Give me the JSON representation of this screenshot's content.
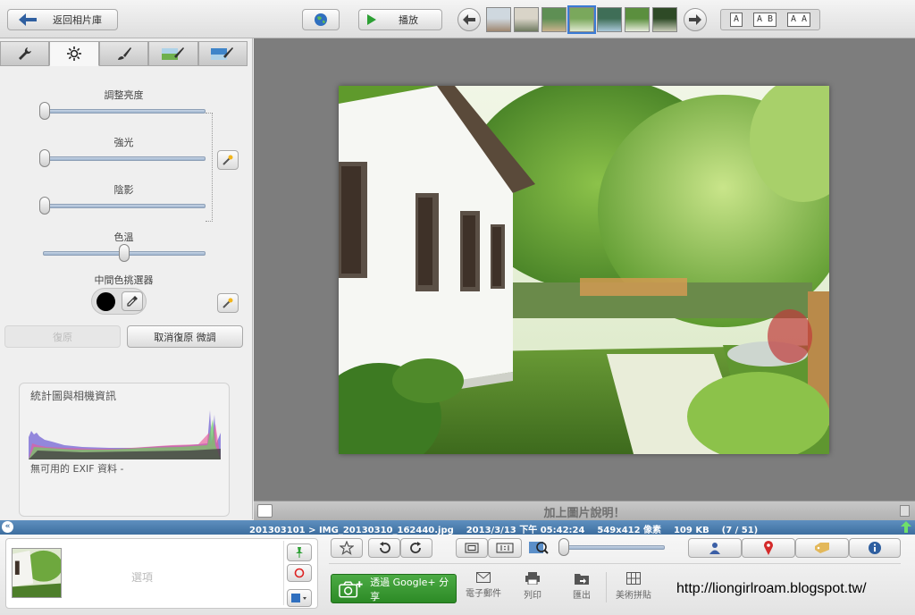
{
  "topbar": {
    "back_label": "返回相片庫",
    "play_label": "播放",
    "thumbnails": [
      {
        "colors": [
          "#cfd8df",
          "#9f8770"
        ]
      },
      {
        "colors": [
          "#d9d4c8",
          "#6f7a60"
        ]
      },
      {
        "colors": [
          "#5e8f54",
          "#c9b28d"
        ]
      },
      {
        "colors": [
          "#7aa85c",
          "#dfe8d0"
        ]
      },
      {
        "colors": [
          "#3f6e57",
          "#a9c7d8"
        ]
      },
      {
        "colors": [
          "#5b8f3e",
          "#e8eddd"
        ]
      },
      {
        "colors": [
          "#2e4a26",
          "#c9cdb9"
        ]
      }
    ],
    "active_thumbnail": 3,
    "text_sizes": [
      "A",
      "A B",
      "A A"
    ]
  },
  "left_panel": {
    "tabs": [
      {
        "icon": "wrench-icon",
        "active": false
      },
      {
        "icon": "sun-icon",
        "active": true
      },
      {
        "icon": "brush-icon",
        "active": false
      },
      {
        "icon": "landscape-brush-icon",
        "active": false
      },
      {
        "icon": "sky-brush-icon",
        "active": false
      }
    ],
    "sliders": {
      "brightness": {
        "label": "調整亮度",
        "value": 0.0
      },
      "highlights": {
        "label": "強光",
        "value": 0.0
      },
      "shadows": {
        "label": "陰影",
        "value": 0.0
      },
      "color_temp": {
        "label": "色溫",
        "value": 0.5
      }
    },
    "picker_label": "中間色挑選器",
    "revert_label": "復原",
    "undo_label": "取消復原 微調",
    "histogram_title": "統計圖與相機資訊",
    "exif_text": "無可用的 EXIF 資料 -"
  },
  "viewer": {
    "caption_placeholder": "加上圖片說明！"
  },
  "infobar": {
    "text": "201303101 > IMG_20130310_162440.jpg    2013/3/13 下午 05:42:24    549x412 像素    109 KB    (7 / 51)"
  },
  "bottom": {
    "tray_label": "選項",
    "share_label": "透過 Google+ 分享",
    "actions": [
      "電子郵件",
      "列印",
      "匯出",
      "美術拼貼"
    ],
    "watermark": "http://liongirlroam.blogspot.tw/"
  },
  "colors": {
    "infobar": "#3d6e9f",
    "share_button": "#2c8a26",
    "viewer_bg": "#7d7d7d"
  }
}
